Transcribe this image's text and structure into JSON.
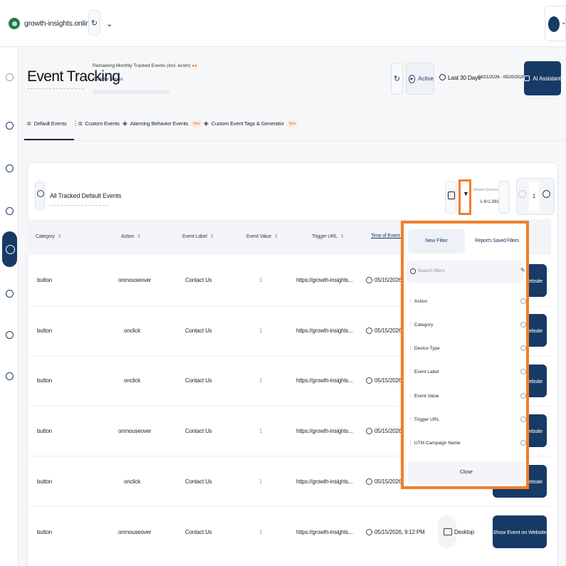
{
  "topbar": {
    "site_name": "growth-insights.online",
    "site_chevron": "chevron-down-icon",
    "refresh_icon": "refresh-icon",
    "avatar_icon": "user-avatar"
  },
  "sidebar": {
    "icons": [
      "collapse-icon",
      "dashboard-icon",
      "inbox-icon",
      "realtime-icon",
      "event-tracking-icon",
      "reports-icon",
      "security-icon",
      "settings-icon"
    ],
    "active_index": 4
  },
  "header": {
    "title": "Event Tracking",
    "remaining_label": "Remaining Monthly Tracked Events (incl. ecom)",
    "details_link": "Click for details",
    "status_label": "Active",
    "range_label": "Last 30 Days",
    "date_range": "04/21/2026 - 05/20/2026",
    "ai_button": "AI Assistant"
  },
  "tabs": [
    {
      "label": "Default Events",
      "active": true
    },
    {
      "label": "Custom Events",
      "active": false
    },
    {
      "label": "Alarming Behavior Events",
      "badge": "New"
    },
    {
      "label": "Custom Event Tags & Generator",
      "badge": "New"
    }
  ],
  "panel": {
    "title": "All Tracked Default Events",
    "entries_label": "Shown Entries",
    "entries_value": "1-6/1,981",
    "page_number": "1"
  },
  "table": {
    "headers": [
      "Category",
      "Action",
      "Event Label",
      "Event Value",
      "Trigger URL",
      "Time of Event Trigg"
    ],
    "rows": [
      {
        "category": "button",
        "action": "onmouseover",
        "label": "Contact Us",
        "value": "1",
        "url": "https://growth-insights...",
        "time": "05/15/2026, 9",
        "device": "",
        "button": "Website"
      },
      {
        "category": "button",
        "action": "onclick",
        "label": "Contact Us",
        "value": "1",
        "url": "https://growth-insights...",
        "time": "05/15/2026, 9",
        "device": "",
        "button": "Website"
      },
      {
        "category": "button",
        "action": "onclick",
        "label": "Contact Us",
        "value": "1",
        "url": "https://growth-insights...",
        "time": "05/15/2026, 9",
        "device": "",
        "button": "Website"
      },
      {
        "category": "button",
        "action": "onmouseover",
        "label": "Contact Us",
        "value": "1",
        "url": "https://growth-insights...",
        "time": "05/15/2026, 9",
        "device": "",
        "button": "Website"
      },
      {
        "category": "button",
        "action": "onclick",
        "label": "Contact Us",
        "value": "1",
        "url": "https://growth-insights...",
        "time": "05/15/2026, 9",
        "device": "",
        "button": "Website"
      },
      {
        "category": "button",
        "action": "onmouseover",
        "label": "Contact Us",
        "value": "1",
        "url": "https://growth-insights...",
        "time": "05/15/2026, 9:12 PM",
        "device": "Desktop",
        "button": "Show Event on Website"
      }
    ]
  },
  "filter_popup": {
    "tab_new": "New Filter",
    "tab_saved": "Report's Saved Filters",
    "search_placeholder": "Search filters",
    "items": [
      "Action",
      "Category",
      "Device Type",
      "Event Label",
      "Event Value",
      "Trigger URL",
      "UTM Campaign Name"
    ],
    "close_label": "Close"
  },
  "colors": {
    "brand_navy": "#173a66",
    "highlight_orange": "#f07f2a"
  }
}
